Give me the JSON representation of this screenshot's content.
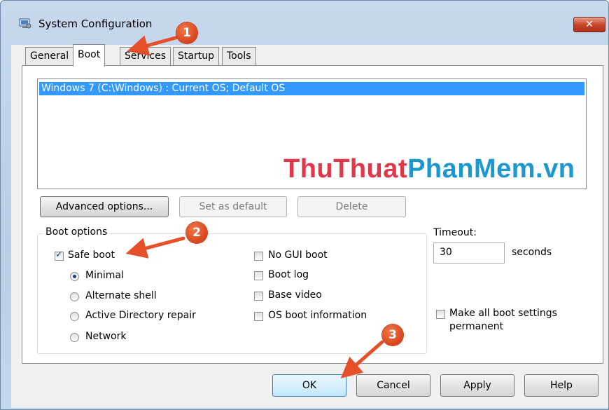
{
  "window": {
    "title": "System Configuration",
    "close_glyph": "✕"
  },
  "tabs": [
    {
      "label": "General",
      "active": false
    },
    {
      "label": "Boot",
      "active": true
    },
    {
      "label": "Services",
      "active": false
    },
    {
      "label": "Startup",
      "active": false
    },
    {
      "label": "Tools",
      "active": false
    }
  ],
  "os_list": {
    "items": [
      "Windows 7 (C:\\Windows) : Current OS; Default OS"
    ],
    "selected_index": 0
  },
  "watermark": {
    "part1": "ThuThuat",
    "part2": "PhanMem.vn"
  },
  "buttons_row": {
    "advanced": "Advanced options...",
    "set_default": "Set as default",
    "delete": "Delete"
  },
  "boot_options": {
    "group_label": "Boot options",
    "safe_boot": {
      "label": "Safe boot",
      "checked": true
    },
    "minimal": "Minimal",
    "alternate_shell": "Alternate shell",
    "ad_repair": "Active Directory repair",
    "network": "Network",
    "selected_mode": "Minimal",
    "no_gui_boot": {
      "label": "No GUI boot",
      "checked": false
    },
    "boot_log": {
      "label": "Boot log",
      "checked": false
    },
    "base_video": {
      "label": "Base video",
      "checked": false
    },
    "os_boot_info": {
      "label": "OS boot information",
      "checked": false
    }
  },
  "timeout": {
    "label": "Timeout:",
    "value": "30",
    "unit": "seconds"
  },
  "permanent": {
    "line1": "Make all boot settings",
    "line2": "permanent",
    "checked": false
  },
  "footer": {
    "ok": "OK",
    "cancel": "Cancel",
    "apply": "Apply",
    "help": "Help"
  },
  "annotations": {
    "step1": "1",
    "step2": "2",
    "step3": "3",
    "color": "#e5502b"
  },
  "colors": {
    "selection": "#3399ff",
    "close_button": "#c9462b",
    "frame": "#b9cde6"
  }
}
